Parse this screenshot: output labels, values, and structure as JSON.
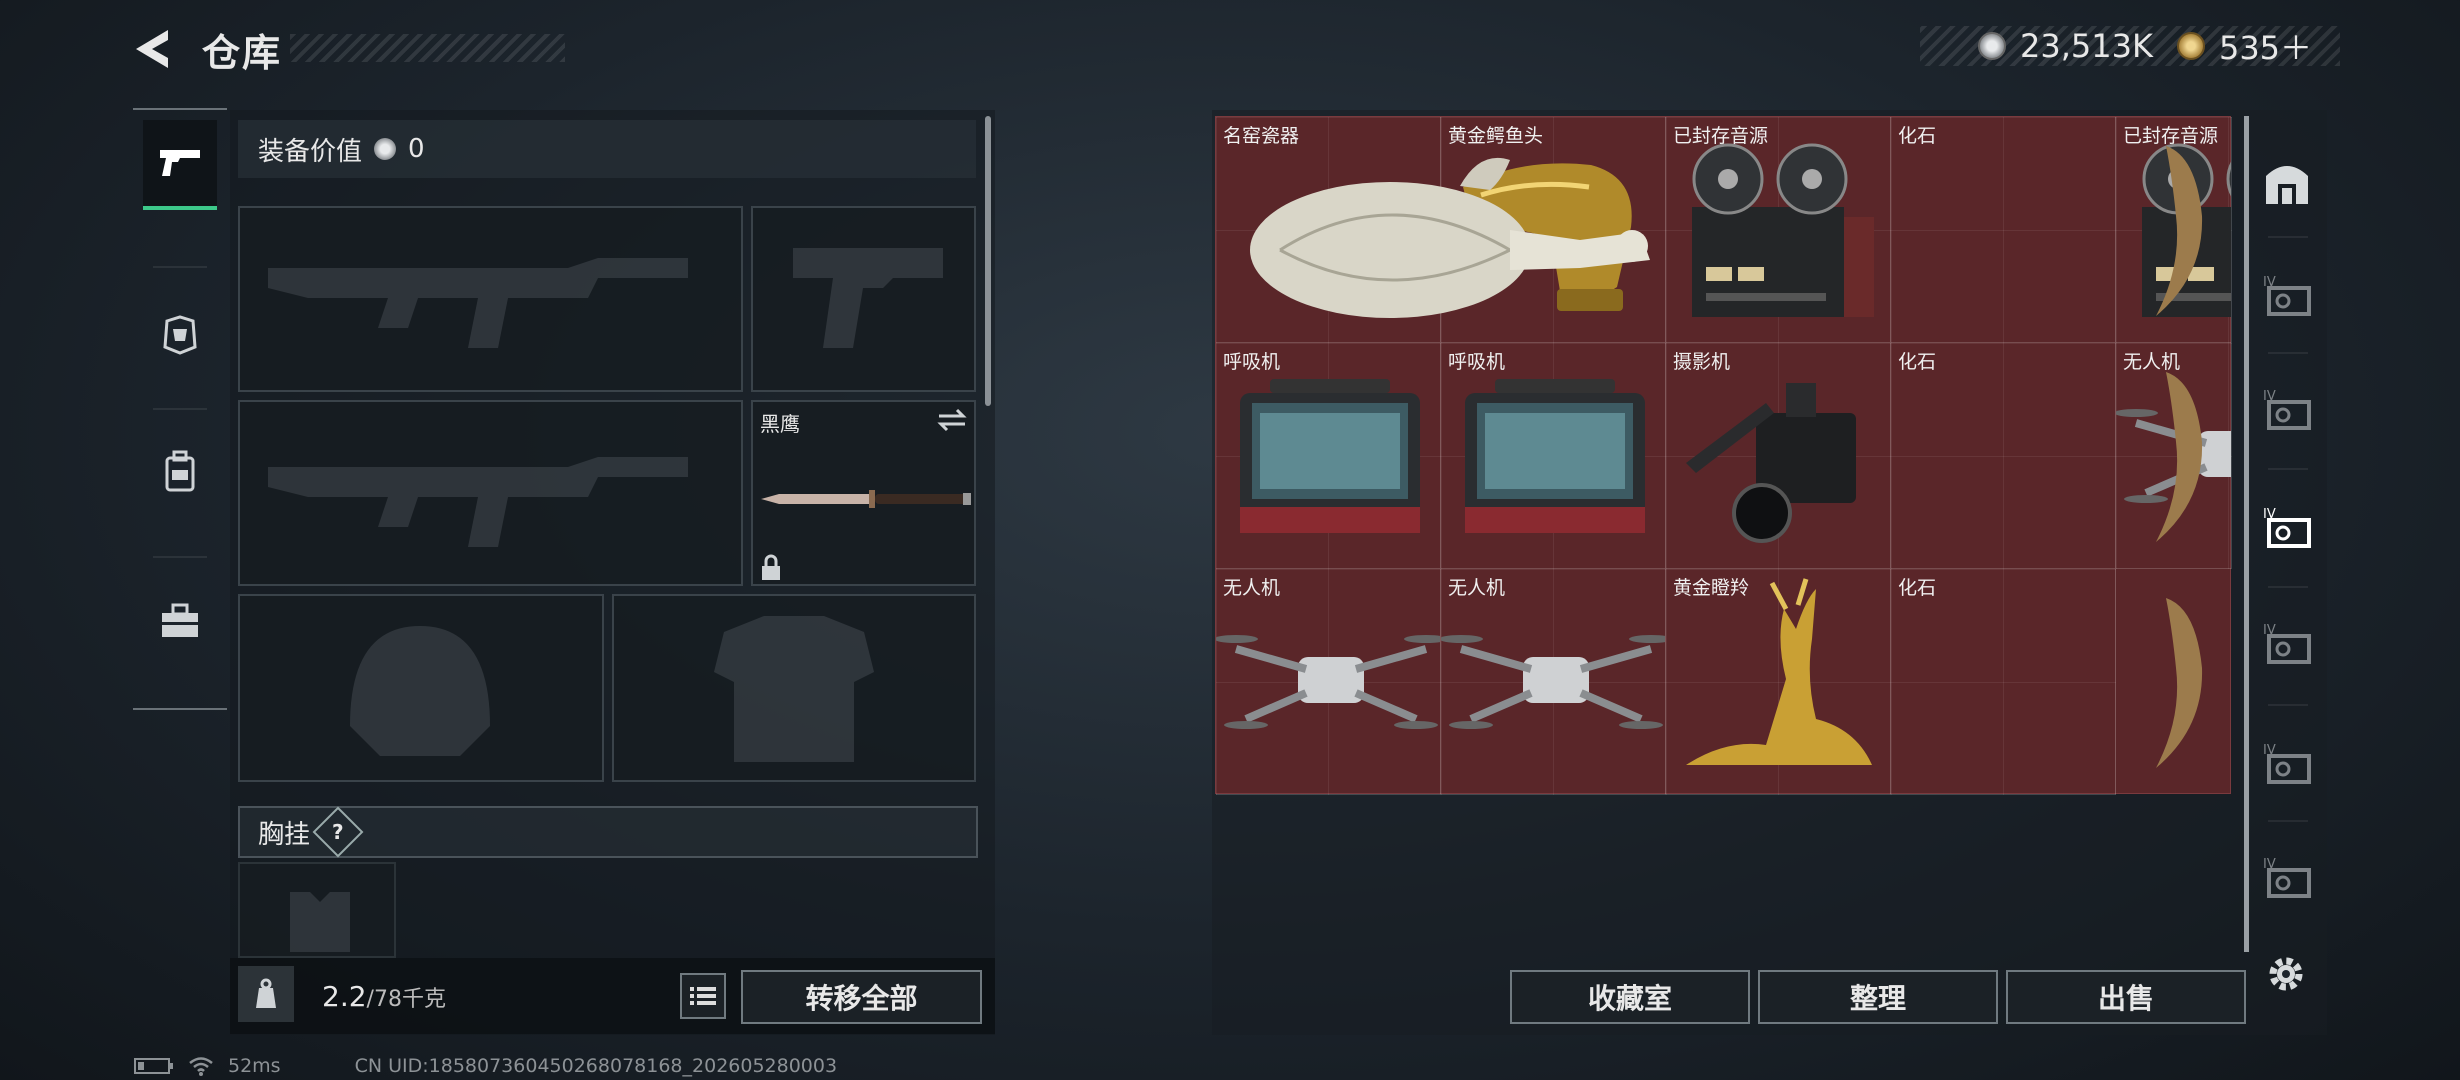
{
  "header": {
    "title": "仓库"
  },
  "currency": {
    "silver": "23,513K",
    "gold": "535＋",
    "silver_color": "#c8ccd0",
    "gold_color": "#c9a45a"
  },
  "loadout": {
    "value_label": "装备价值",
    "value": "0",
    "knife_name": "黑鹰",
    "vest_label": "胸挂",
    "vest_help": "?",
    "weight_current": "2.2",
    "weight_max": "/78千克",
    "transfer_all": "转移全部"
  },
  "tabs": [
    {
      "icon": "pistol-icon",
      "active": true
    },
    {
      "icon": "helmet-icon",
      "active": false
    },
    {
      "icon": "backpack-icon",
      "active": false
    },
    {
      "icon": "toolbox-icon",
      "active": false
    }
  ],
  "stash": {
    "background_color": "#5a2629",
    "items": [
      {
        "name": "名窑瓷器",
        "icon": "porcelain-vase-icon"
      },
      {
        "name": "黄金鳄鱼头",
        "icon": "gold-crocodile-head-icon"
      },
      {
        "name": "已封存音源",
        "icon": "reel-tape-recorder-icon"
      },
      {
        "name": "化石",
        "icon": "fossil-claw-icon"
      },
      {
        "name": "已封存音源",
        "icon": "reel-tape-recorder-icon"
      },
      {
        "name": "呼吸机",
        "icon": "ventilator-icon"
      },
      {
        "name": "呼吸机",
        "icon": "ventilator-icon"
      },
      {
        "name": "摄影机",
        "icon": "video-camera-icon"
      },
      {
        "name": "化石",
        "icon": "fossil-claw-icon"
      },
      {
        "name": "无人机",
        "icon": "drone-icon"
      },
      {
        "name": "无人机",
        "icon": "drone-icon"
      },
      {
        "name": "无人机",
        "icon": "drone-icon"
      },
      {
        "name": "黄金瞪羚",
        "icon": "gold-gazelle-icon"
      },
      {
        "name": "化石",
        "icon": "fossil-claw-icon"
      }
    ]
  },
  "actions": {
    "collection": "收藏室",
    "sort": "整理",
    "sell": "出售"
  },
  "rail": [
    {
      "icon": "vault-icon"
    },
    {
      "icon": "crate-iv-icon",
      "label": "IV"
    },
    {
      "icon": "crate-iv-icon",
      "label": "IV"
    },
    {
      "icon": "crate-iv-icon",
      "label": "IV"
    },
    {
      "icon": "crate-iv-icon",
      "label": "IV"
    },
    {
      "icon": "crate-iv-icon",
      "label": "IV"
    },
    {
      "icon": "crate-iv-icon",
      "label": "IV"
    }
  ],
  "status": {
    "ping": "52ms",
    "uid": "CN UID:185807360450268078168_202605280003"
  }
}
